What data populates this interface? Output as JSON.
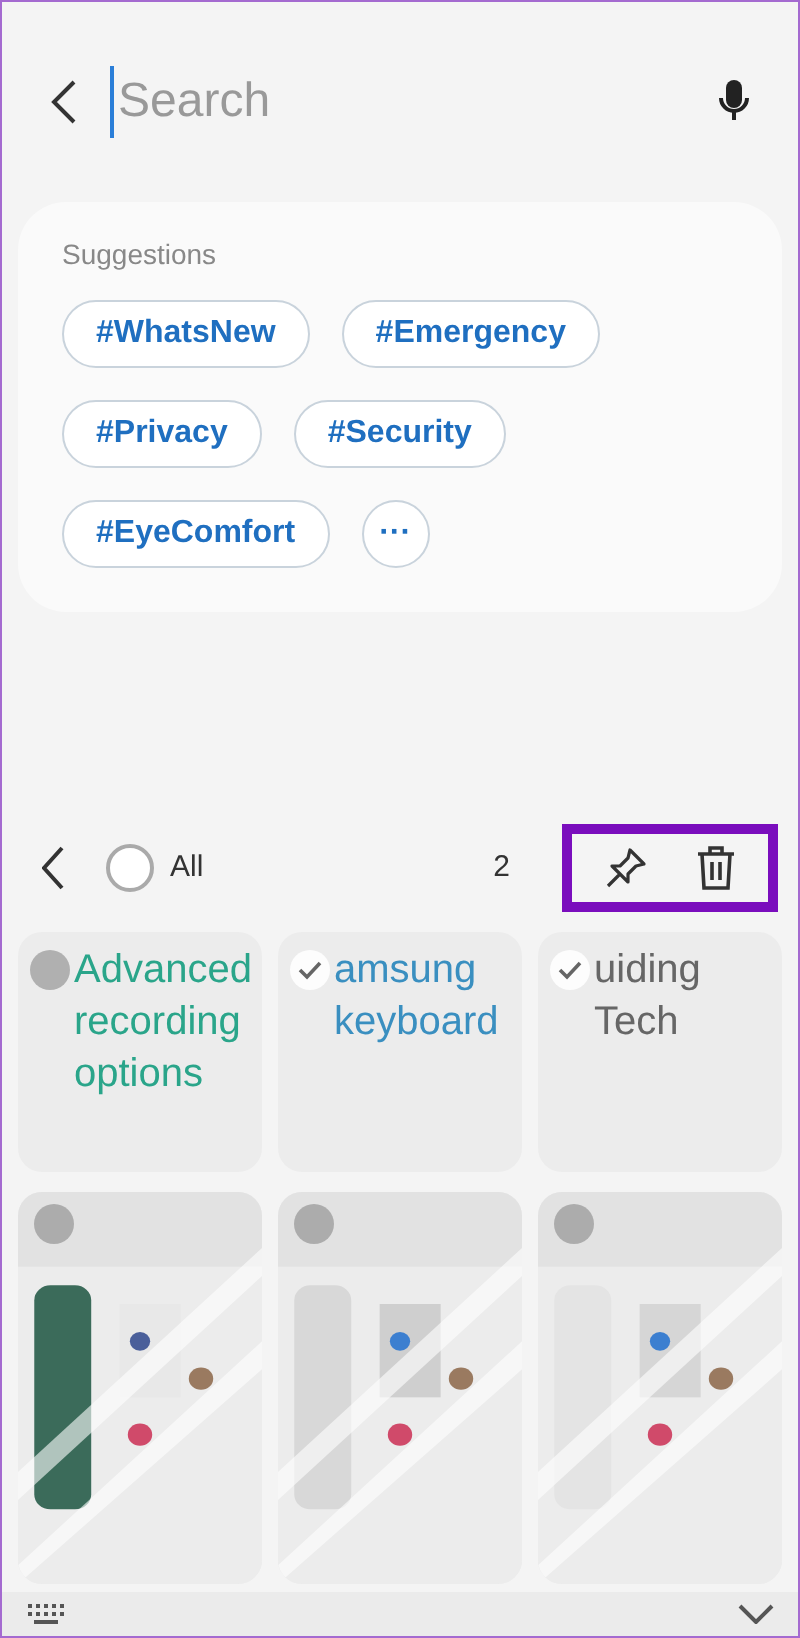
{
  "search": {
    "placeholder": "Search"
  },
  "suggestions": {
    "title": "Suggestions",
    "tags": [
      {
        "label": "#WhatsNew"
      },
      {
        "label": "#Emergency"
      },
      {
        "label": "#Privacy"
      },
      {
        "label": "#Security"
      },
      {
        "label": "#EyeComfort"
      }
    ],
    "more": "···"
  },
  "selection_bar": {
    "all_label": "All",
    "all_checked": false,
    "count": "2"
  },
  "notes": [
    {
      "kind": "text",
      "text": "Advanced recording options",
      "color": "#2aa58a",
      "selected": false
    },
    {
      "kind": "text",
      "text": "amsung keyboard",
      "color": "#3a8fc0",
      "selected": true
    },
    {
      "kind": "text",
      "text": "uiding Tech",
      "color": "#666666",
      "selected": true
    },
    {
      "kind": "picture",
      "selected": false
    },
    {
      "kind": "picture",
      "selected": false
    },
    {
      "kind": "picture",
      "selected": false
    }
  ]
}
